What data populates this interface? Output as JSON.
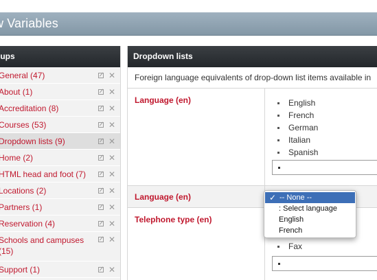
{
  "title": "w Variables",
  "groups_panel": {
    "header": "oups",
    "items": [
      {
        "label": "General (47)"
      },
      {
        "label": "About (1)"
      },
      {
        "label": "Accreditation (8)"
      },
      {
        "label": "Courses (53)"
      },
      {
        "label": "Dropdown lists (9)",
        "selected": true
      },
      {
        "label": "Home (2)"
      },
      {
        "label": "HTML head and foot (7)"
      },
      {
        "label": "Locations (2)"
      },
      {
        "label": "Partners (1)"
      },
      {
        "label": "Reservation (4)"
      },
      {
        "label": "Schools and campuses (15)"
      },
      {
        "label": "Support (1)"
      }
    ]
  },
  "main_panel": {
    "header": "Dropdown lists",
    "description": "Foreign language equivalents of drop-down list items available in",
    "rows": [
      {
        "name": "Language (en)",
        "items": [
          "English",
          "French",
          "German",
          "Italian",
          "Spanish"
        ]
      },
      {
        "name": "Language (en)"
      },
      {
        "name": "Telephone type (en)",
        "items": [
          "Fax"
        ]
      }
    ]
  },
  "dropdown": {
    "options": [
      {
        "label": "-- None --",
        "selected": true,
        "check": "✓"
      },
      {
        "label": ": Select language"
      },
      {
        "label": "English"
      },
      {
        "label": "French"
      }
    ]
  },
  "colors": {
    "accent_red": "#c0182e",
    "header_dark": "#2b2f33",
    "title_bar": "#8fa2b1",
    "highlight": "#3d6fb7"
  },
  "icons": {
    "edit": "edit-icon",
    "delete": "close-icon",
    "check": "checkmark-icon"
  }
}
